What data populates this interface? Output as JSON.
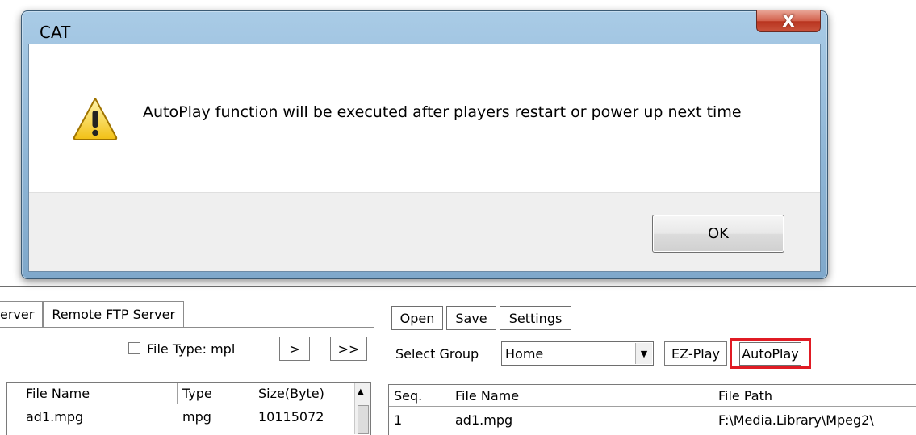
{
  "dialog": {
    "title": "CAT",
    "close_label": "X",
    "message": "AutoPlay function will be executed after players restart or power up next time",
    "ok_label": "OK",
    "icon": "warning-icon"
  },
  "left_panel": {
    "tabs": [
      "erver",
      "Remote FTP Server"
    ],
    "file_type_label": "File Type: mpl",
    "file_type_checked": false,
    "next_label": ">",
    "all_label": ">>",
    "columns": [
      "File Name",
      "Type",
      "Size(Byte)"
    ],
    "rows": [
      {
        "name": "ad1.mpg",
        "type": "mpg",
        "size": "10115072"
      }
    ]
  },
  "right_panel": {
    "toolbar": {
      "open": "Open",
      "save": "Save",
      "settings": "Settings"
    },
    "select_group_label": "Select Group",
    "group_value": "Home",
    "ez_play": "EZ-Play",
    "autoplay": "AutoPlay",
    "columns": [
      "Seq.",
      "File Name",
      "File Path"
    ],
    "rows": [
      {
        "seq": "1",
        "name": "ad1.mpg",
        "path": "F:\\Media.Library\\Mpeg2\\"
      }
    ]
  },
  "colors": {
    "highlight": "#e01b24",
    "dialog_frame": "#8fb6d6",
    "close_button": "#c9523b"
  }
}
